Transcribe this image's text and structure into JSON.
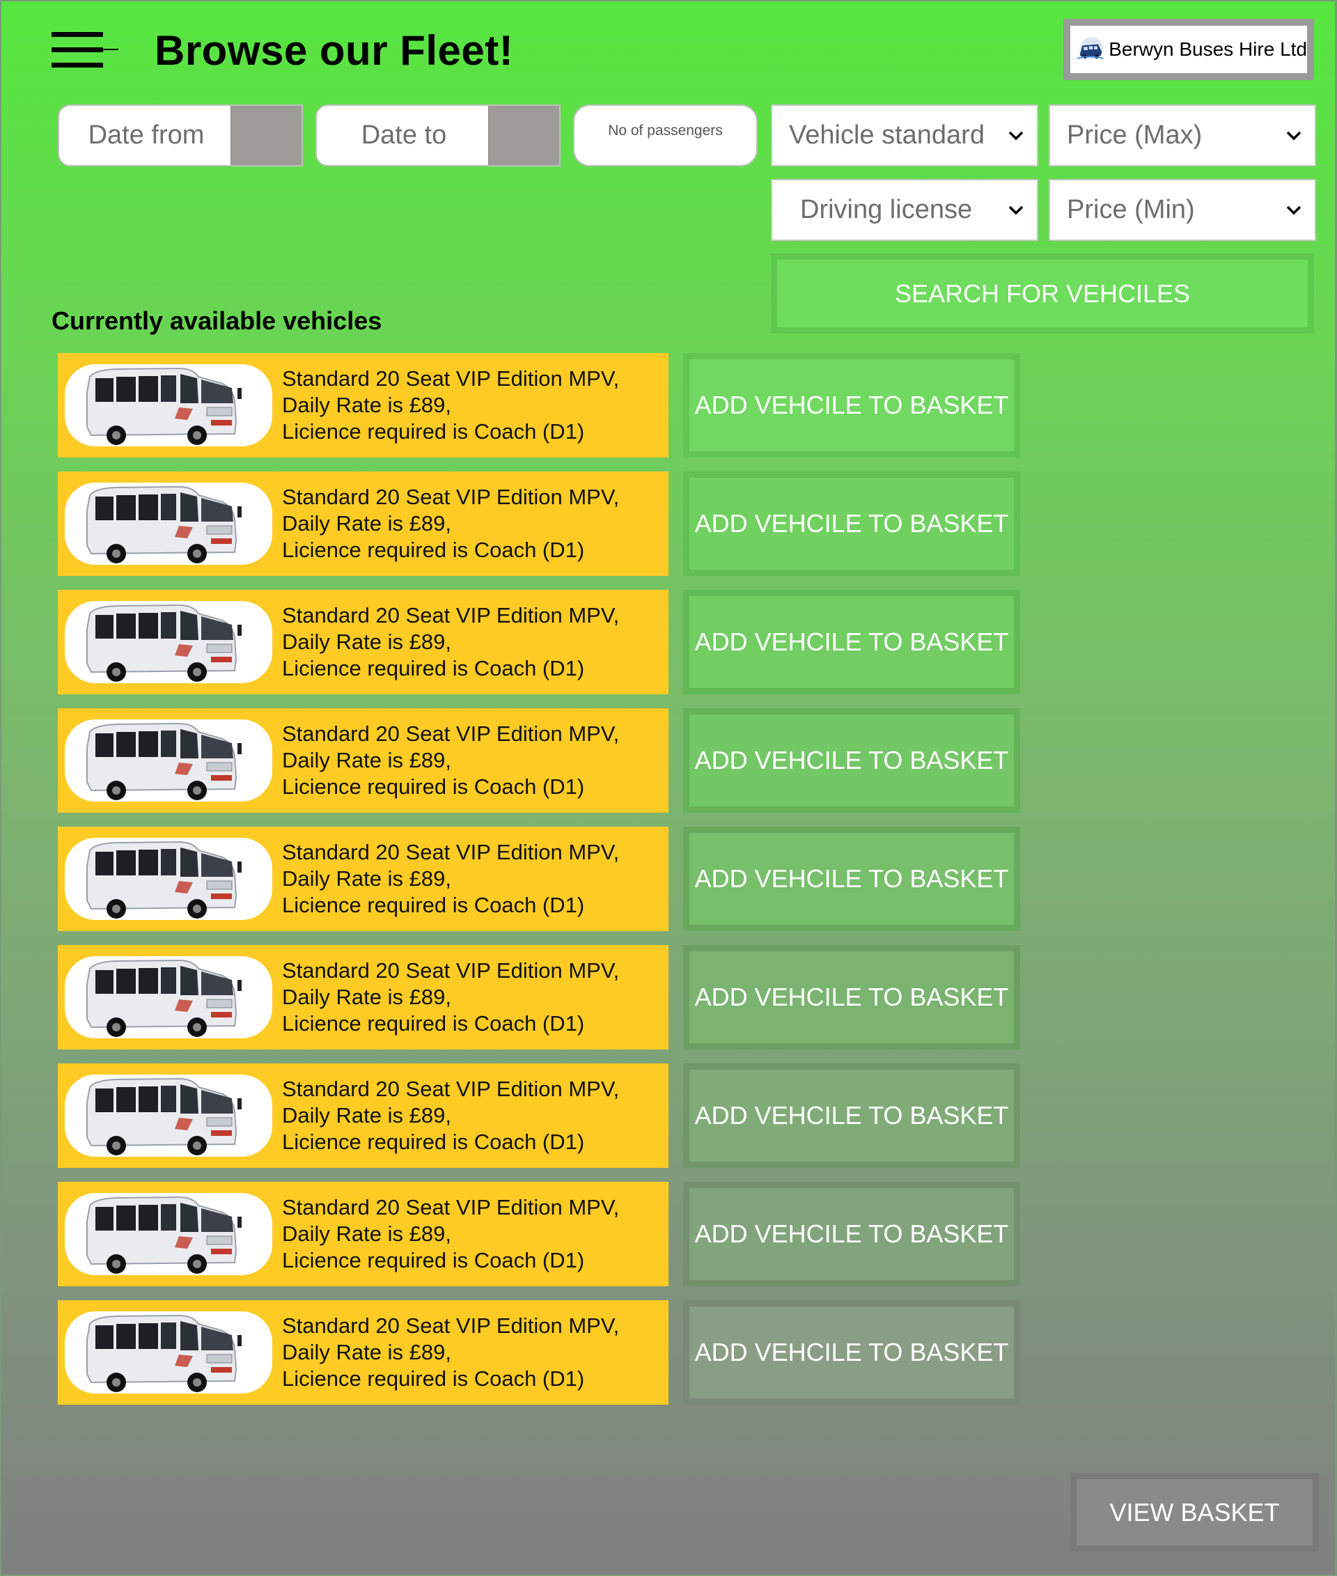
{
  "header": {
    "title": "Browse our Fleet!",
    "logo_text": "Berwyn Buses Hire Ltd",
    "menu_icon": "hamburger-menu-icon"
  },
  "filters": {
    "date_from": "Date from",
    "date_to": "Date to",
    "passengers_placeholder": "No of passengers",
    "vehicle_standard": "Vehicle standard",
    "price_max": "Price (Max)",
    "driving_license": "Driving license",
    "price_min": "Price (Min)",
    "search_label": "SEARCH FOR VEHCILES"
  },
  "section_title": "Currently available vehicles",
  "vehicles": [
    {
      "line1": "Standard 20 Seat VIP Edition MPV,",
      "line2": "Daily Rate is £89,",
      "line3": "Licience required is Coach (D1)",
      "button": "ADD VEHCILE TO BASKET"
    },
    {
      "line1": "Standard 20 Seat VIP Edition MPV,",
      "line2": "Daily Rate is £89,",
      "line3": "Licience required is Coach (D1)",
      "button": "ADD VEHCILE TO BASKET"
    },
    {
      "line1": "Standard 20 Seat VIP Edition MPV,",
      "line2": "Daily Rate is £89,",
      "line3": "Licience required is Coach (D1)",
      "button": "ADD VEHCILE TO BASKET"
    },
    {
      "line1": "Standard 20 Seat VIP Edition MPV,",
      "line2": "Daily Rate is £89,",
      "line3": "Licience required is Coach (D1)",
      "button": "ADD VEHCILE TO BASKET"
    },
    {
      "line1": "Standard 20 Seat VIP Edition MPV,",
      "line2": "Daily Rate is £89,",
      "line3": "Licience required is Coach (D1)",
      "button": "ADD VEHCILE TO BASKET"
    },
    {
      "line1": "Standard 20 Seat VIP Edition MPV,",
      "line2": "Daily Rate is £89,",
      "line3": "Licience required is Coach (D1)",
      "button": "ADD VEHCILE TO BASKET"
    },
    {
      "line1": "Standard 20 Seat VIP Edition MPV,",
      "line2": "Daily Rate is £89,",
      "line3": "Licience required is Coach (D1)",
      "button": "ADD VEHCILE TO BASKET"
    },
    {
      "line1": "Standard 20 Seat VIP Edition MPV,",
      "line2": "Daily Rate is £89,",
      "line3": "Licience required is Coach (D1)",
      "button": "ADD VEHCILE TO BASKET"
    },
    {
      "line1": "Standard 20 Seat VIP Edition MPV,",
      "line2": "Daily Rate is £89,",
      "line3": "Licience required is Coach (D1)",
      "button": "ADD VEHCILE TO BASKET"
    }
  ],
  "footer": {
    "view_basket": "VIEW BASKET"
  },
  "colors": {
    "card_yellow": "#fdcb24",
    "search_green": "#6edc5d"
  }
}
